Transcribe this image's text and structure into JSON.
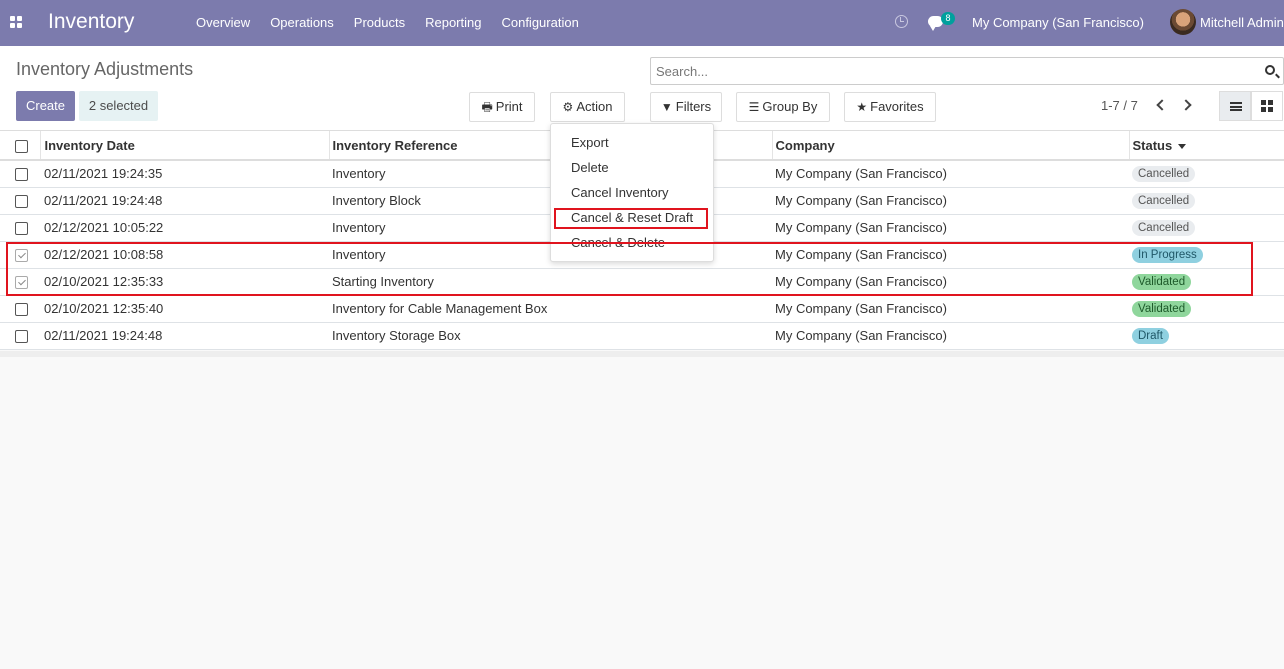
{
  "navbar": {
    "brand": "Inventory",
    "menu": [
      "Overview",
      "Operations",
      "Products",
      "Reporting",
      "Configuration"
    ],
    "chat_badge": "8",
    "company": "My Company (San Francisco)",
    "user": "Mitchell Admin"
  },
  "control_panel": {
    "title": "Inventory Adjustments",
    "create_label": "Create",
    "selected_label": "2 selected",
    "print_label": "Print",
    "action_label": "Action",
    "search_placeholder": "Search...",
    "filters_label": "Filters",
    "groupby_label": "Group By",
    "favorites_label": "Favorites",
    "pager": "1-7 / 7"
  },
  "action_menu": {
    "items": [
      "Export",
      "Delete",
      "Cancel Inventory",
      "Cancel & Reset Draft",
      "Cancel & Delete"
    ]
  },
  "table": {
    "headers": {
      "date": "Inventory Date",
      "reference": "Inventory Reference",
      "company": "Company",
      "status": "Status"
    },
    "rows": [
      {
        "date": "02/11/2021 19:24:35",
        "reference": "Inventory",
        "company": "My Company (San Francisco)",
        "status": "Cancelled",
        "checked": false
      },
      {
        "date": "02/11/2021 19:24:48",
        "reference": "Inventory Block",
        "company": "My Company (San Francisco)",
        "status": "Cancelled",
        "checked": false
      },
      {
        "date": "02/12/2021 10:05:22",
        "reference": "Inventory",
        "company": "My Company (San Francisco)",
        "status": "Cancelled",
        "checked": false
      },
      {
        "date": "02/12/2021 10:08:58",
        "reference": "Inventory",
        "company": "My Company (San Francisco)",
        "status": "In Progress",
        "checked": true
      },
      {
        "date": "02/10/2021 12:35:33",
        "reference": "Starting Inventory",
        "company": "My Company (San Francisco)",
        "status": "Validated",
        "checked": true
      },
      {
        "date": "02/10/2021 12:35:40",
        "reference": "Inventory for Cable Management Box",
        "company": "My Company (San Francisco)",
        "status": "Validated",
        "checked": false
      },
      {
        "date": "02/11/2021 19:24:48",
        "reference": "Inventory Storage Box",
        "company": "My Company (San Francisco)",
        "status": "Draft",
        "checked": false
      }
    ]
  },
  "colors": {
    "navbar": "#7c7bad",
    "highlight": "#e0141e"
  }
}
